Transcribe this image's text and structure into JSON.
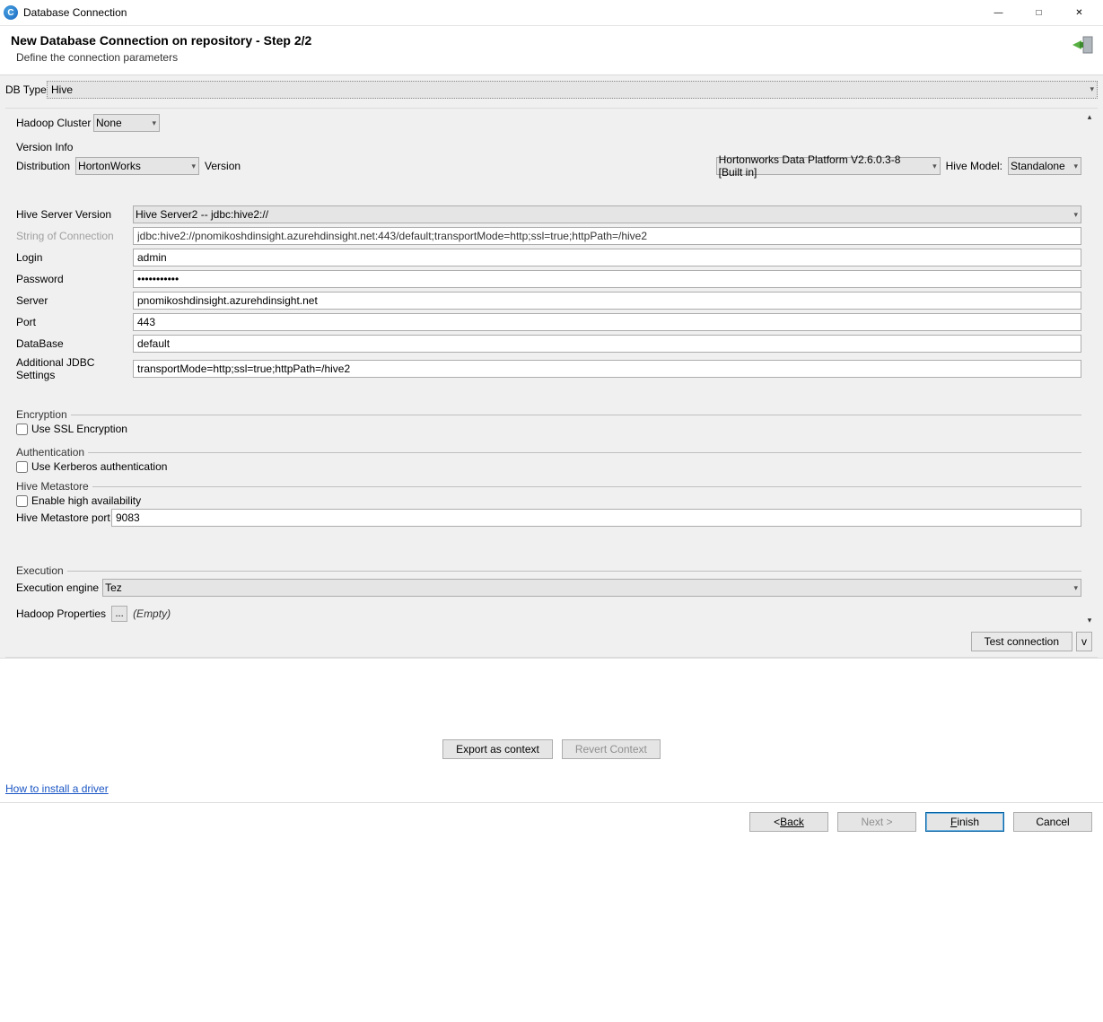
{
  "window": {
    "title": "Database Connection"
  },
  "header": {
    "title": "New Database Connection on repository - Step 2/2",
    "subtitle": "Define the connection parameters"
  },
  "dbtype": {
    "label": "DB Type",
    "value": "Hive"
  },
  "hadoop_cluster": {
    "label": "Hadoop Cluster",
    "value": "None"
  },
  "version_info": {
    "title": "Version Info",
    "distribution_label": "Distribution",
    "distribution_value": "HortonWorks",
    "version_label": "Version",
    "version_value": "Hortonworks Data Platform V2.6.0.3-8 [Built in]",
    "hive_model_label": "Hive Model:",
    "hive_model_value": "Standalone"
  },
  "fields": {
    "hive_server_version": {
      "label": "Hive Server Version",
      "value": "Hive Server2 -- jdbc:hive2://"
    },
    "conn_string": {
      "label": "String of Connection",
      "value": "jdbc:hive2://pnomikoshdinsight.azurehdinsight.net:443/default;transportMode=http;ssl=true;httpPath=/hive2"
    },
    "login": {
      "label": "Login",
      "value": "admin"
    },
    "password": {
      "label": "Password",
      "value": "•••••••••••"
    },
    "server": {
      "label": "Server",
      "value": "pnomikoshdinsight.azurehdinsight.net"
    },
    "port": {
      "label": "Port",
      "value": "443"
    },
    "database": {
      "label": "DataBase",
      "value": "default"
    },
    "jdbc_settings": {
      "label": "Additional JDBC Settings",
      "value": "transportMode=http;ssl=true;httpPath=/hive2"
    }
  },
  "encryption": {
    "title": "Encryption",
    "ssl_label": "Use SSL Encryption"
  },
  "auth": {
    "title": "Authentication",
    "kerberos_label": "Use Kerberos authentication"
  },
  "metastore": {
    "title": "Hive Metastore",
    "ha_label": "Enable high availability",
    "port_label": "Hive Metastore port",
    "port_value": "9083"
  },
  "execution": {
    "title": "Execution",
    "engine_label": "Execution engine",
    "engine_value": "Tez"
  },
  "hadoop_props": {
    "label": "Hadoop Properties",
    "btn": "...",
    "note": "(Empty)"
  },
  "test_connection": "Test connection",
  "v_button": "v",
  "mid": {
    "export": "Export as context",
    "revert": "Revert Context"
  },
  "driver_link": "How to install a driver",
  "footer": {
    "back": "Back",
    "next": "Next >",
    "finish": "Finish",
    "cancel": "Cancel"
  }
}
